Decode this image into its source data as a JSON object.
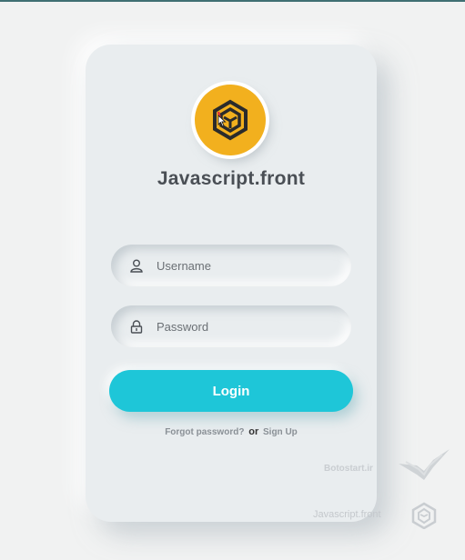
{
  "brand": {
    "title": "Javascript.front",
    "logo_icon": "js-front-hexagon-icon",
    "logo_color": "#f2b01e"
  },
  "form": {
    "username": {
      "placeholder": "Username",
      "icon": "user-icon"
    },
    "password": {
      "placeholder": "Password",
      "icon": "lock-icon"
    },
    "login_label": "Login",
    "login_color": "#1ec6d8"
  },
  "footer_links": {
    "forgot_label": "Forgot password?",
    "or_label": "or",
    "signup_label": "Sign Up"
  },
  "watermarks": {
    "site_label": "Botostart.ir",
    "brand_label": "Javascript.front"
  }
}
